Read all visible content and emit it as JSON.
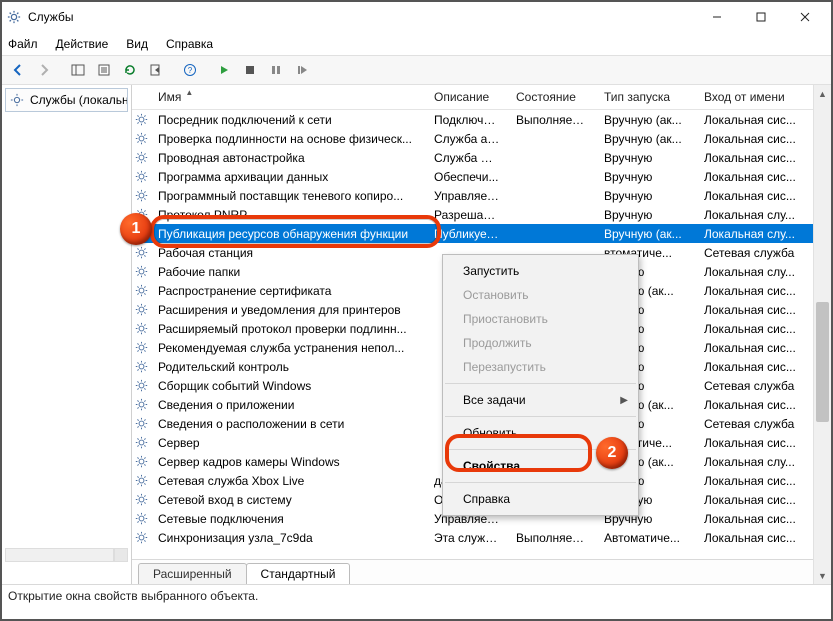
{
  "window": {
    "title": "Службы"
  },
  "menu": {
    "file": "Файл",
    "action": "Действие",
    "view": "Вид",
    "help": "Справка"
  },
  "nav": {
    "services": "Службы (локальные)"
  },
  "columns": {
    "name": "Имя",
    "desc": "Описание",
    "state": "Состояние",
    "start": "Тип запуска",
    "logon": "Вход от имени"
  },
  "rows": [
    {
      "name": "Посредник подключений к сети",
      "desc": "Подключе...",
      "state": "Выполняется",
      "start": "Вручную (ак...",
      "logon": "Локальная сис..."
    },
    {
      "name": "Проверка подлинности на основе физическ...",
      "desc": "Служба аг...",
      "state": "",
      "start": "Вручную (ак...",
      "logon": "Локальная сис..."
    },
    {
      "name": "Проводная автонастройка",
      "desc": "Служба W...",
      "state": "",
      "start": "Вручную",
      "logon": "Локальная сис..."
    },
    {
      "name": "Программа архивации данных",
      "desc": "Обеспечи...",
      "state": "",
      "start": "Вручную",
      "logon": "Локальная сис..."
    },
    {
      "name": "Программный поставщик теневого копиро...",
      "desc": "Управляет...",
      "state": "",
      "start": "Вручную",
      "logon": "Локальная сис..."
    },
    {
      "name": "Протокол PNRP",
      "desc": "Разрешает...",
      "state": "",
      "start": "Вручную",
      "logon": "Локальная слу..."
    },
    {
      "name": "Публикация ресурсов обнаружения функции",
      "desc": "Публикует...",
      "state": "",
      "start": "Вручную (ак...",
      "logon": "Локальная слу...",
      "sel": true
    },
    {
      "name": "Рабочая станция",
      "desc": "",
      "state": "",
      "start": "втоматиче...",
      "logon": "Сетевая служба"
    },
    {
      "name": "Рабочие папки",
      "desc": "",
      "state": "",
      "start": "ручную",
      "logon": "Локальная слу..."
    },
    {
      "name": "Распространение сертификата",
      "desc": "",
      "state": "",
      "start": "ручную (ак...",
      "logon": "Локальная сис..."
    },
    {
      "name": "Расширения и уведомления для принтеров",
      "desc": "",
      "state": "",
      "start": "ручную",
      "logon": "Локальная сис..."
    },
    {
      "name": "Расширяемый протокол проверки подлинн...",
      "desc": "",
      "state": "",
      "start": "ручную",
      "logon": "Локальная сис..."
    },
    {
      "name": "Рекомендуемая служба устранения непол...",
      "desc": "",
      "state": "",
      "start": "ручную",
      "logon": "Локальная сис..."
    },
    {
      "name": "Родительский контроль",
      "desc": "",
      "state": "",
      "start": "ручную",
      "logon": "Локальная сис..."
    },
    {
      "name": "Сборщик событий Windows",
      "desc": "",
      "state": "",
      "start": "ручную",
      "logon": "Сетевая служба"
    },
    {
      "name": "Сведения о приложении",
      "desc": "",
      "state": "",
      "start": "ручную (ак...",
      "logon": "Локальная сис..."
    },
    {
      "name": "Сведения о расположении в сети",
      "desc": "",
      "state": "",
      "start": "ручную",
      "logon": "Сетевая служба"
    },
    {
      "name": "Сервер",
      "desc": "",
      "state": "",
      "start": "втоматиче...",
      "logon": "Локальная сис..."
    },
    {
      "name": "Сервер кадров камеры Windows",
      "desc": "",
      "state": "",
      "start": "ручную (ак...",
      "logon": "Локальная слу..."
    },
    {
      "name": "Сетевая служба Xbox Live",
      "desc": "данная сл...",
      "state": "",
      "start": "ручную",
      "logon": "Локальная сис..."
    },
    {
      "name": "Сетевой вход в систему",
      "desc": "Обеспечи...",
      "state": "",
      "start": "Вручную",
      "logon": "Локальная сис..."
    },
    {
      "name": "Сетевые подключения",
      "desc": "Управляет...",
      "state": "",
      "start": "Вручную",
      "logon": "Локальная сис..."
    },
    {
      "name": "Синхронизация узла_7c9da",
      "desc": "Эта служб...",
      "state": "Выполняется",
      "start": "Автоматиче...",
      "logon": "Локальная сис..."
    }
  ],
  "context": {
    "start": "Запустить",
    "stop": "Остановить",
    "pause": "Приостановить",
    "resume": "Продолжить",
    "restart": "Перезапустить",
    "alltasks": "Все задачи",
    "refresh": "Обновить",
    "properties": "Свойства",
    "help": "Справка"
  },
  "tabs": {
    "extended": "Расширенный",
    "standard": "Стандартный"
  },
  "status": "Открытие окна свойств выбранного объекта.",
  "badges": {
    "b1": "1",
    "b2": "2"
  }
}
